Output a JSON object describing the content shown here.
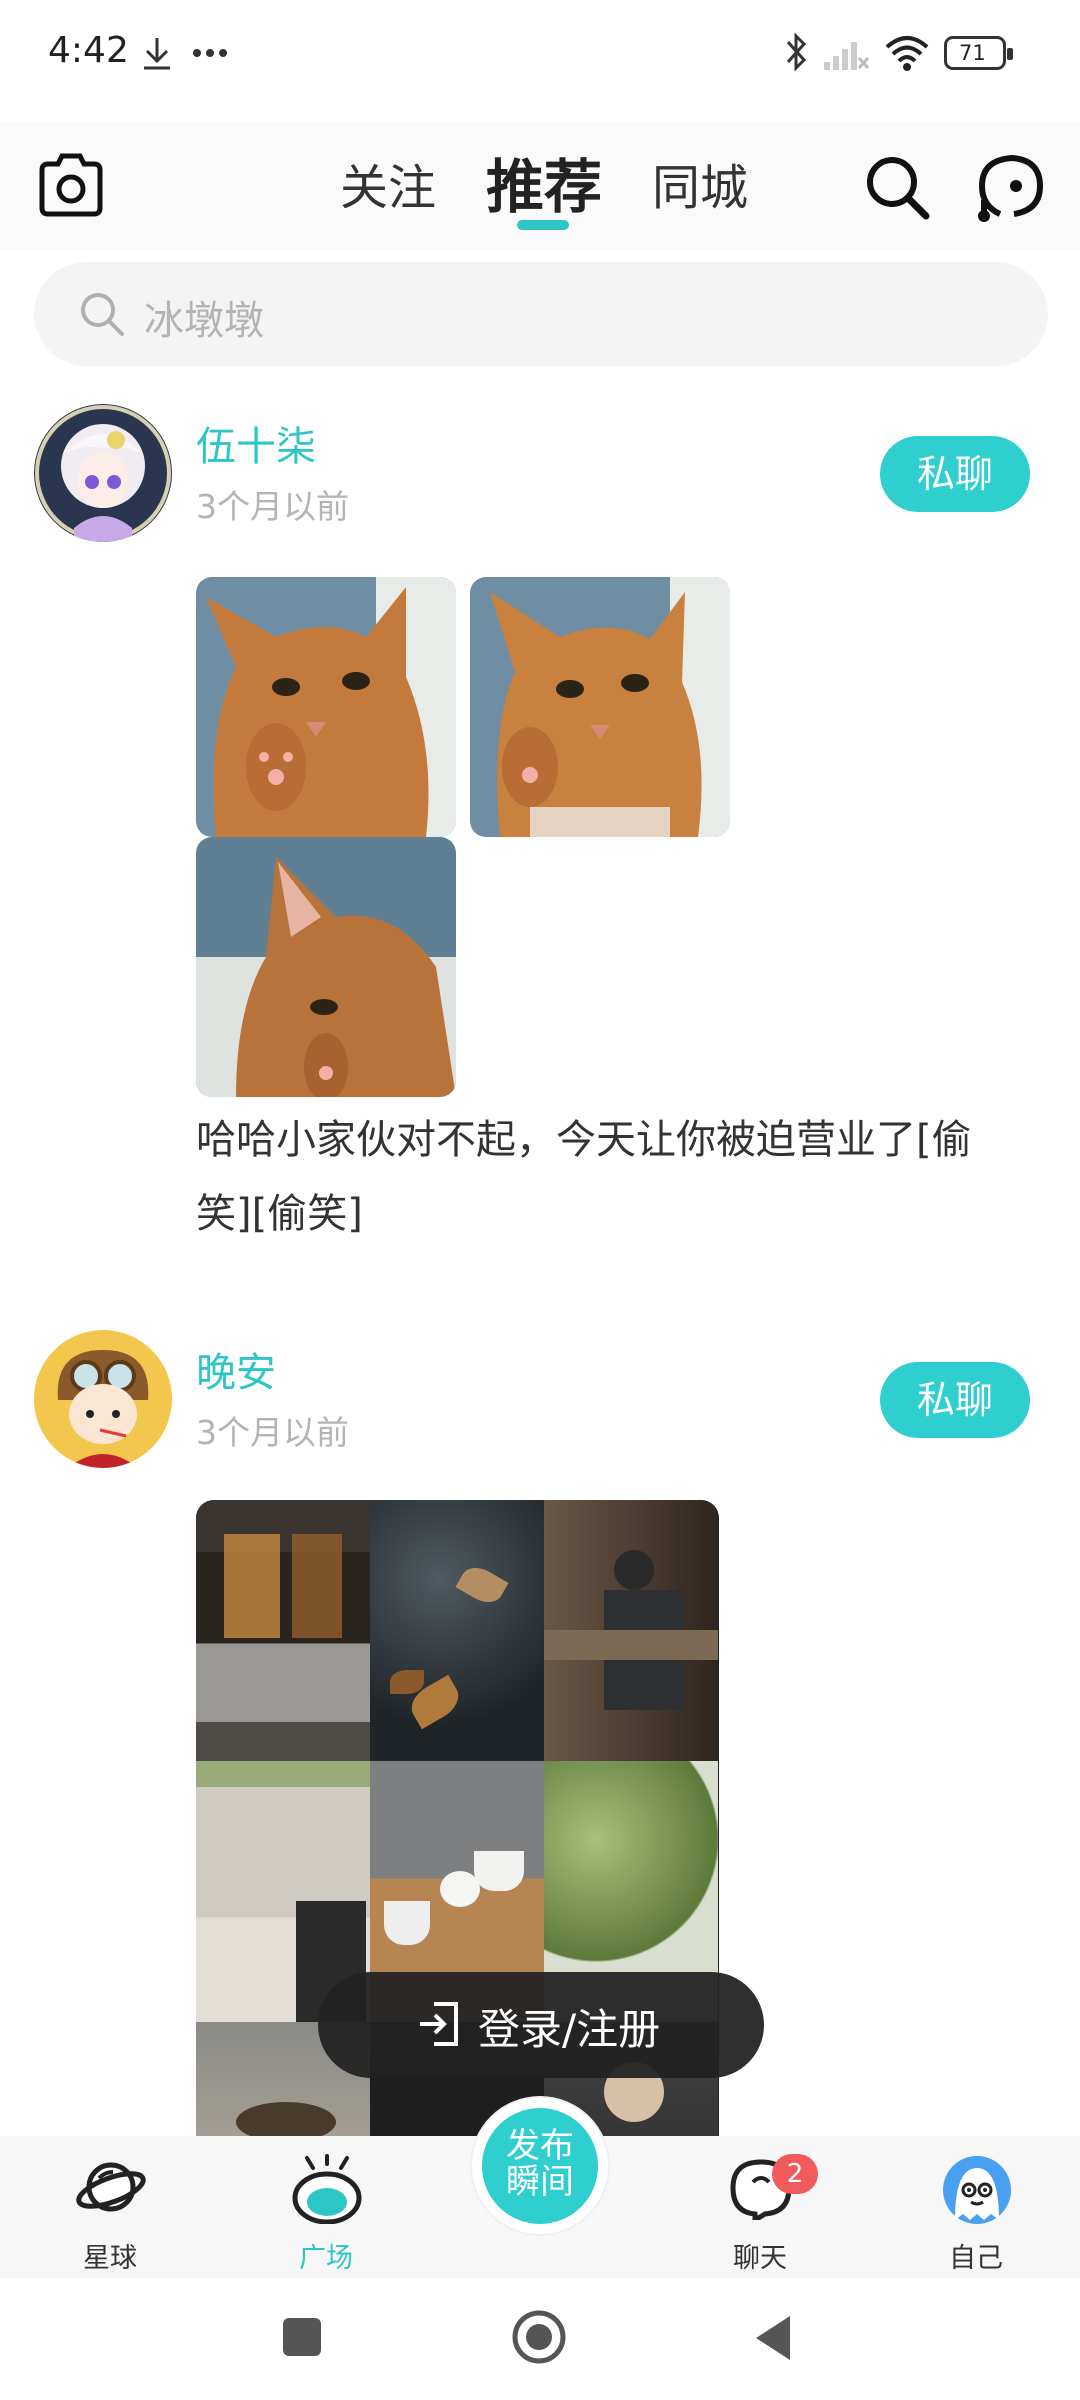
{
  "status_bar": {
    "time": "4:42",
    "icons": [
      "download-icon",
      "more-dots-icon",
      "bluetooth-icon",
      "signal-icon",
      "wifi-icon",
      "battery-icon"
    ],
    "battery": "71"
  },
  "top_nav": {
    "tabs": [
      {
        "label": "关注",
        "active": false
      },
      {
        "label": "推荐",
        "active": true
      },
      {
        "label": "同城",
        "active": false
      }
    ],
    "icons": [
      "camera-icon",
      "search-icon",
      "music-chat-icon"
    ]
  },
  "search": {
    "placeholder": "冰墩墩"
  },
  "posts": [
    {
      "username": "伍十柒",
      "time": "3个月以前",
      "chat_label": "私聊",
      "text": "哈哈小家伙对不起，今天让你被迫营业了[偷笑][偷笑]",
      "photos": [
        "cat-photo-1",
        "cat-photo-2",
        "cat-photo-3"
      ]
    },
    {
      "username": "晚安",
      "time": "3个月以前",
      "chat_label": "私聊",
      "photos": [
        "cafe-window",
        "rain-leaves",
        "cafe-counter",
        "white-building",
        "coffee-cups",
        "green-leaves",
        "food-bowl",
        "empty",
        "portrait"
      ]
    }
  ],
  "login": {
    "label": "登录/注册"
  },
  "bottom_nav": {
    "items": [
      {
        "label": "星球",
        "icon": "planet-icon",
        "active": false
      },
      {
        "label": "广场",
        "icon": "square-eye-icon",
        "active": true
      },
      {
        "label": "聊天",
        "icon": "chat-bubble-icon",
        "active": false,
        "badge": "2"
      },
      {
        "label": "自己",
        "icon": "ghost-avatar-icon",
        "active": false
      }
    ],
    "publish_line1": "发布",
    "publish_line2": "瞬间"
  },
  "colors": {
    "accent": "#2dc6c6",
    "badge": "#f25b5b",
    "text": "#333333",
    "muted": "#b4b4b4"
  }
}
